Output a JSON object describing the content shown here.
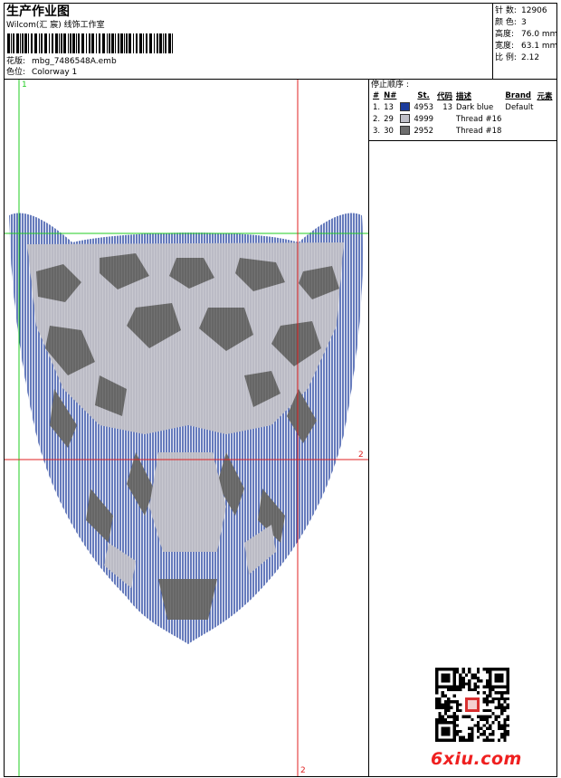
{
  "header": {
    "title": "生产作业图",
    "company": "Wilcom(汇 宸) 线饰工作室",
    "design_label": "花版:",
    "design_file": "mbg_7486548A.emb",
    "colorway_label": "色位:",
    "colorway": "Colorway 1"
  },
  "stats": [
    {
      "label": "针 数:",
      "value": "12906"
    },
    {
      "label": "颜 色:",
      "value": "3"
    },
    {
      "label": "高度:",
      "value": "76.0 mm"
    },
    {
      "label": "宽度:",
      "value": "63.1 mm"
    },
    {
      "label": "比 例:",
      "value": "2.12"
    }
  ],
  "legend": {
    "title": "停止顺序 :",
    "headers": [
      "#",
      "N#",
      "St.",
      "代码",
      "描述",
      "Brand",
      "元素"
    ],
    "rows": [
      {
        "num": "1.",
        "n": "13",
        "color": "#1c3c9c",
        "stitches": "4953",
        "code": "13",
        "desc": "Dark blue",
        "brand": "Default",
        "element": ""
      },
      {
        "num": "2.",
        "n": "29",
        "color": "#c0c0c8",
        "stitches": "4999",
        "code": "",
        "desc": "Thread #16",
        "brand": "",
        "element": ""
      },
      {
        "num": "3.",
        "n": "30",
        "color": "#6e6e6e",
        "stitches": "2952",
        "code": "",
        "desc": "Thread #18",
        "brand": "",
        "element": ""
      }
    ]
  },
  "markers": {
    "green_1": "1",
    "red_2_right": "2",
    "red_2_bottom": "2"
  },
  "watermark": {
    "logo": "6xiu.com"
  },
  "colors": {
    "blue": "#1c3c9c",
    "silver": "#c0c0c8",
    "gray": "#6e6e6e",
    "guide_green": "#22cc22",
    "guide_red": "#e02020"
  }
}
